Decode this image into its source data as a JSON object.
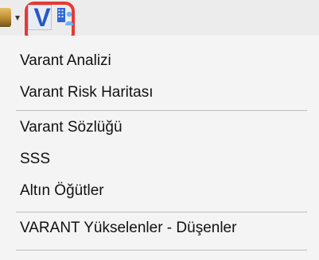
{
  "toolbar": {
    "left_icon": "folder-icon",
    "dropdown_icon": "chevron-down-icon",
    "highlighted_button": {
      "label": "V",
      "icon": "v-icon",
      "accent_color": "#2459c8",
      "highlight_color": "#e53935"
    },
    "right_icon": "building-person-icon"
  },
  "menu": {
    "items": [
      "Varant Analizi",
      "Varant Risk Haritası",
      "Varant Sözlüğü",
      "SSS",
      "Altın Öğütler",
      "VARANT Yükselenler - Düşenler"
    ]
  }
}
